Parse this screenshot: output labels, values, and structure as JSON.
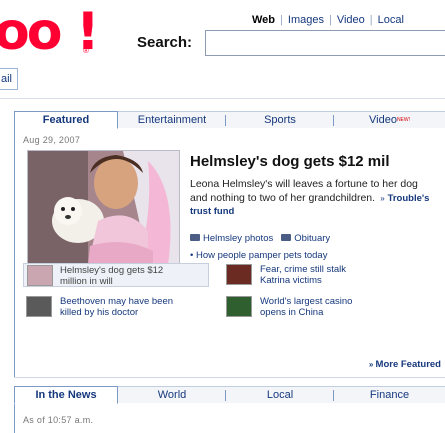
{
  "logo": {
    "text": "oo",
    "excl": "!",
    "reg": "®"
  },
  "search": {
    "tabs": [
      {
        "label": "Web",
        "active": true
      },
      {
        "label": "Images",
        "active": false
      },
      {
        "label": "Video",
        "active": false
      },
      {
        "label": "Local",
        "active": false
      }
    ],
    "label": "Search:",
    "value": ""
  },
  "mail": {
    "label": "ail"
  },
  "featured": {
    "tabs": [
      {
        "label": "Featured",
        "active": true
      },
      {
        "label": "Entertainment",
        "active": false
      },
      {
        "label": "Sports",
        "active": false
      },
      {
        "label": "Video",
        "badge": "NEW!",
        "active": false
      }
    ],
    "date": "Aug 29, 2007",
    "headline": "Helmsley's dog gets $12 mil",
    "story": "Leona Helmsley's will leaves a fortune to her dog and nothing to two of her grandchildren.",
    "story_more": "Trouble's trust fund",
    "media_links": [
      {
        "label": "Helmsley photos",
        "icon": "camera-icon"
      },
      {
        "label": "Obituary",
        "icon": "obituary-icon"
      }
    ],
    "bullet_link": "How people pamper pets today",
    "related": [
      {
        "line1": "Helmsley's dog gets $12",
        "line2": "million in will"
      },
      {
        "line1": "Fear, crime still stalk",
        "line2": "Katrina victims"
      },
      {
        "line1": "Beethoven may have been",
        "line2": "killed by his doctor"
      },
      {
        "line1": "World's largest casino",
        "line2": "opens in China"
      }
    ],
    "more_link": "More Featured"
  },
  "news": {
    "tabs": [
      {
        "label": "In the News",
        "active": true
      },
      {
        "label": "World",
        "active": false
      },
      {
        "label": "Local",
        "active": false
      },
      {
        "label": "Finance",
        "active": false
      }
    ],
    "as_of": "As of 10:57 a.m."
  },
  "colors": {
    "brand": "#ff0033",
    "link": "#16387c",
    "tab_border": "#7d9ac7"
  }
}
